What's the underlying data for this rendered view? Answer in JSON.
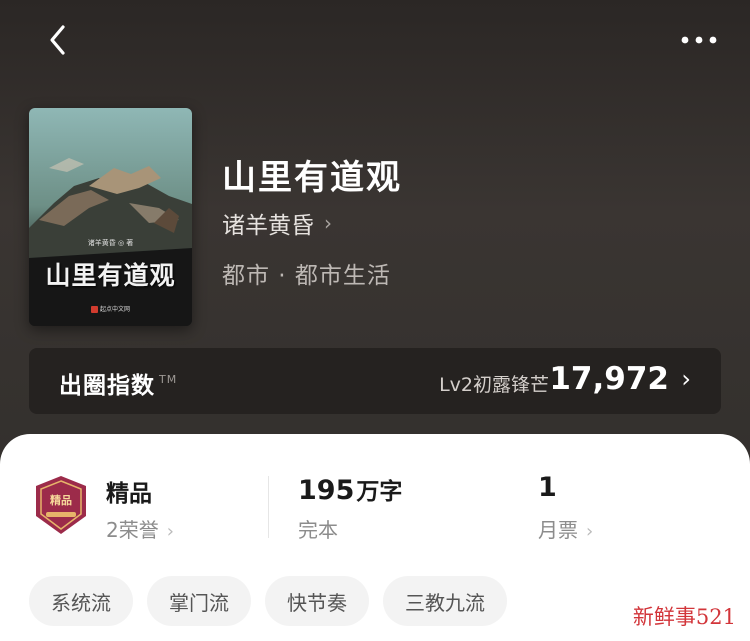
{
  "header": {
    "back_icon": "chevron-left-icon",
    "more_icon": "more-dots-icon"
  },
  "cover": {
    "title": "山里有道观",
    "author": "诸羊黄昏 ◎ 著",
    "publisher": "起点中文网"
  },
  "book": {
    "title": "山里有道观",
    "author": "诸羊黄昏",
    "genre": "都市 · 都市生活"
  },
  "index": {
    "label": "出圈指数",
    "tm": "TM",
    "level": "Lv2初露锋芒",
    "value": "17,972"
  },
  "stats": {
    "quality": {
      "title": "精品",
      "sub": "2荣誉",
      "badge_text": "精品"
    },
    "words": {
      "value": "195",
      "unit": "万字",
      "sub": "完本"
    },
    "tickets": {
      "value": "1",
      "sub": "月票"
    }
  },
  "tags": [
    "系统流",
    "掌门流",
    "快节奏",
    "三教九流"
  ],
  "watermark": "新鲜事521",
  "colors": {
    "hero_bg": "#33302d",
    "index_bar": "#252220",
    "sheet_bg": "#ffffff",
    "tag_bg": "#f3f3f3",
    "badge": "#9c2b4a",
    "watermark": "#d2353a"
  }
}
